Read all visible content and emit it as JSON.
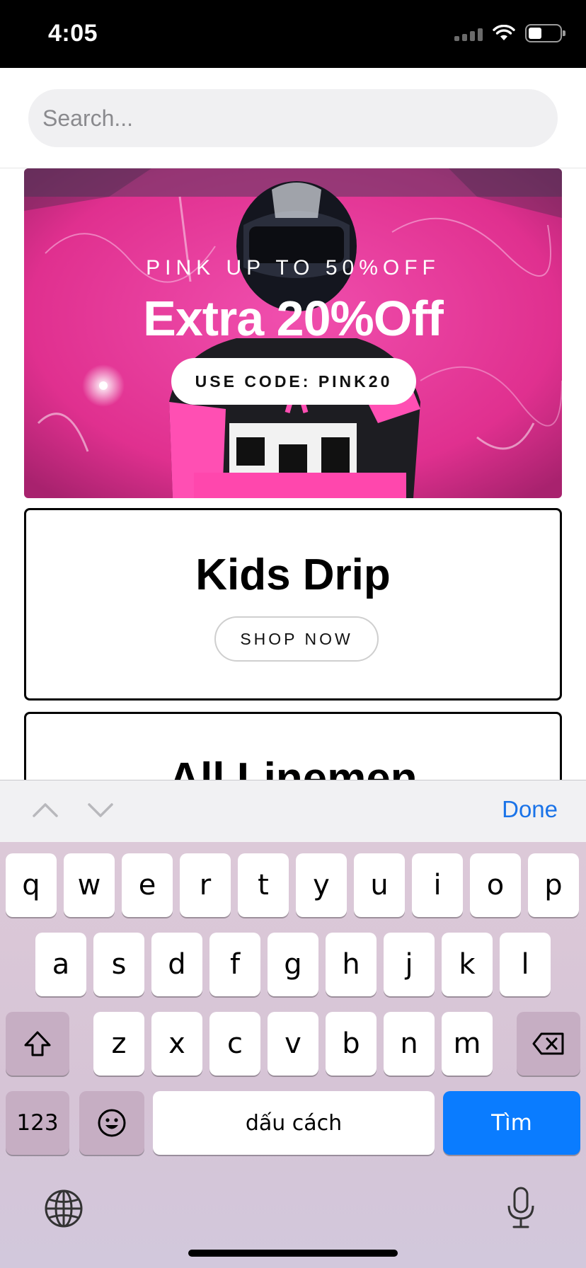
{
  "status_bar": {
    "time": "4:05"
  },
  "search": {
    "placeholder": "Search..."
  },
  "hero": {
    "subtitle": "PINK UP TO 50%OFF",
    "title": "Extra 20%Off",
    "code_label": "USE CODE: PINK20"
  },
  "cards": [
    {
      "title": "Kids Drip",
      "button": "SHOP NOW"
    },
    {
      "title": "All Linemen"
    }
  ],
  "accessory_bar": {
    "done_label": "Done"
  },
  "keyboard": {
    "row1": [
      "q",
      "w",
      "e",
      "r",
      "t",
      "y",
      "u",
      "i",
      "o",
      "p"
    ],
    "row2": [
      "a",
      "s",
      "d",
      "f",
      "g",
      "h",
      "j",
      "k",
      "l"
    ],
    "row3": [
      "z",
      "x",
      "c",
      "v",
      "b",
      "n",
      "m"
    ],
    "numbers_label": "123",
    "space_label": "dấu cách",
    "search_label": "Tìm"
  },
  "colors": {
    "accent": "#1a73e8",
    "search_key": "#0a7cff",
    "hero_pink": "#e8319a"
  },
  "icons": [
    "wifi-icon",
    "battery-icon",
    "signal-icon",
    "shift-icon",
    "delete-icon",
    "emoji-icon",
    "globe-icon",
    "microphone-icon",
    "chevron-up-icon",
    "chevron-down-icon"
  ]
}
